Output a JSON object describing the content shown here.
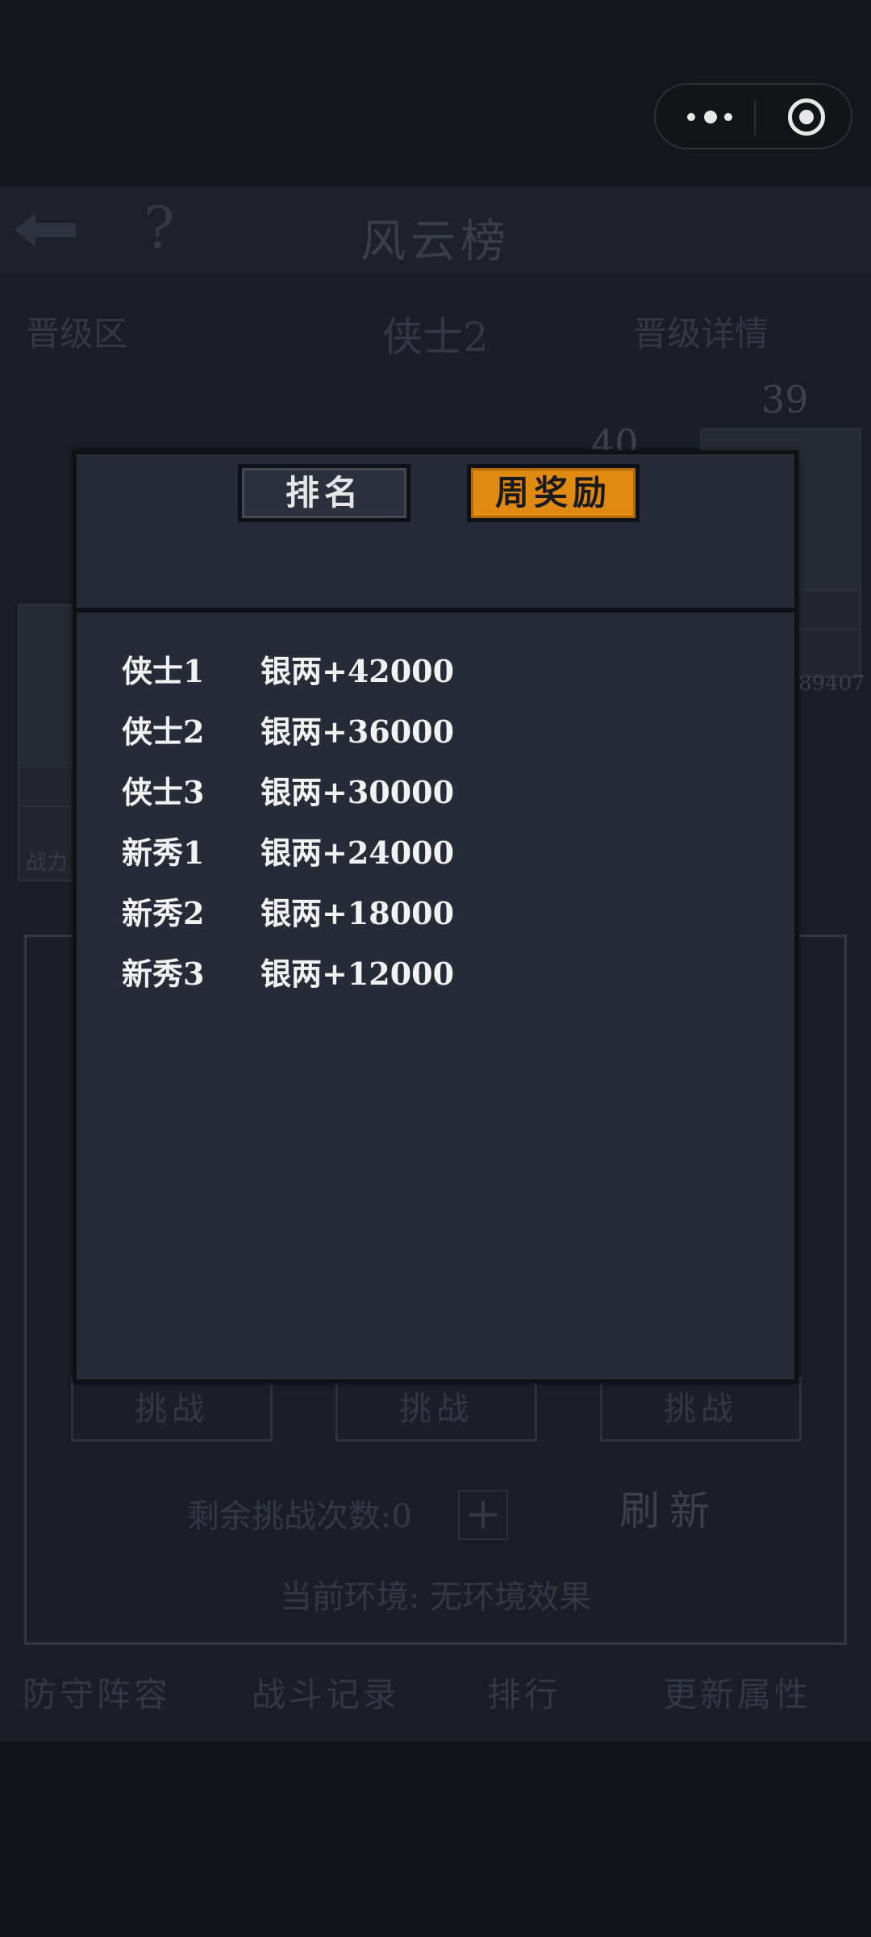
{
  "game": {
    "title": "风云榜",
    "promo_zone": "晋级区",
    "tier_label": "侠士2",
    "promo_detail": "晋级详情",
    "rank_39": "39",
    "rank_40": "40",
    "power_left": "战力",
    "power_right": "89407",
    "challenge_label": "挑战",
    "remaining_label": "剩余挑战次数:0",
    "plus": "+",
    "refresh": "刷新",
    "environment": "当前环境: 无环境效果",
    "nav": [
      "防守阵容",
      "战斗记录",
      "排行",
      "更新属性"
    ]
  },
  "modal": {
    "tabs": [
      {
        "label": "排名",
        "active": false
      },
      {
        "label": "周奖励",
        "active": true
      }
    ],
    "rewards": [
      {
        "tier": "侠士1",
        "amount": "银两+42000"
      },
      {
        "tier": "侠士2",
        "amount": "银两+36000"
      },
      {
        "tier": "侠士3",
        "amount": "银两+30000"
      },
      {
        "tier": "新秀1",
        "amount": "银两+24000"
      },
      {
        "tier": "新秀2",
        "amount": "银两+18000"
      },
      {
        "tier": "新秀3",
        "amount": "银两+12000"
      }
    ]
  },
  "colors": {
    "active_tab": "#e18a12",
    "modal_bg": "#272b38",
    "background": "#15171c"
  },
  "icons": [
    "more-dots-icon",
    "target-icon",
    "back-arrow-icon",
    "help-icon"
  ]
}
